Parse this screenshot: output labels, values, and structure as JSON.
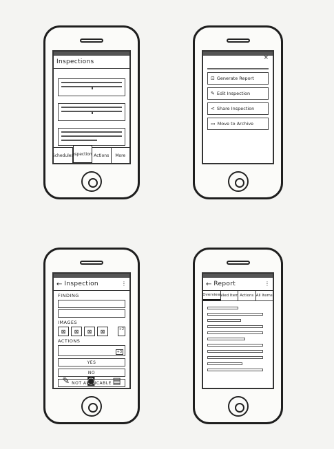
{
  "screens": {
    "inspections": {
      "title": "Inspections",
      "tabs": [
        "Schedules",
        "Inspections",
        "Actions",
        "More"
      ]
    },
    "menu": {
      "close_glyph": "×",
      "items": [
        {
          "icon": "open-report-icon",
          "label": "Generate Report"
        },
        {
          "icon": "edit-icon",
          "label": "Edit Inspection"
        },
        {
          "icon": "share-icon",
          "label": "Share Inspection"
        },
        {
          "icon": "archive-icon",
          "label": "Move to Archive"
        }
      ]
    },
    "inspection": {
      "title": "Inspection",
      "finding_label": "FINDING",
      "images_label": "IMAGES",
      "images_more": "+2",
      "actions_label": "ACTIONS",
      "actions_more": "+3",
      "answers": [
        "YES",
        "NO",
        "NOT APPLICABLE"
      ]
    },
    "report": {
      "title": "Report",
      "tabs": [
        "Overview",
        "Failed Items",
        "Actions",
        "All Items"
      ]
    }
  }
}
